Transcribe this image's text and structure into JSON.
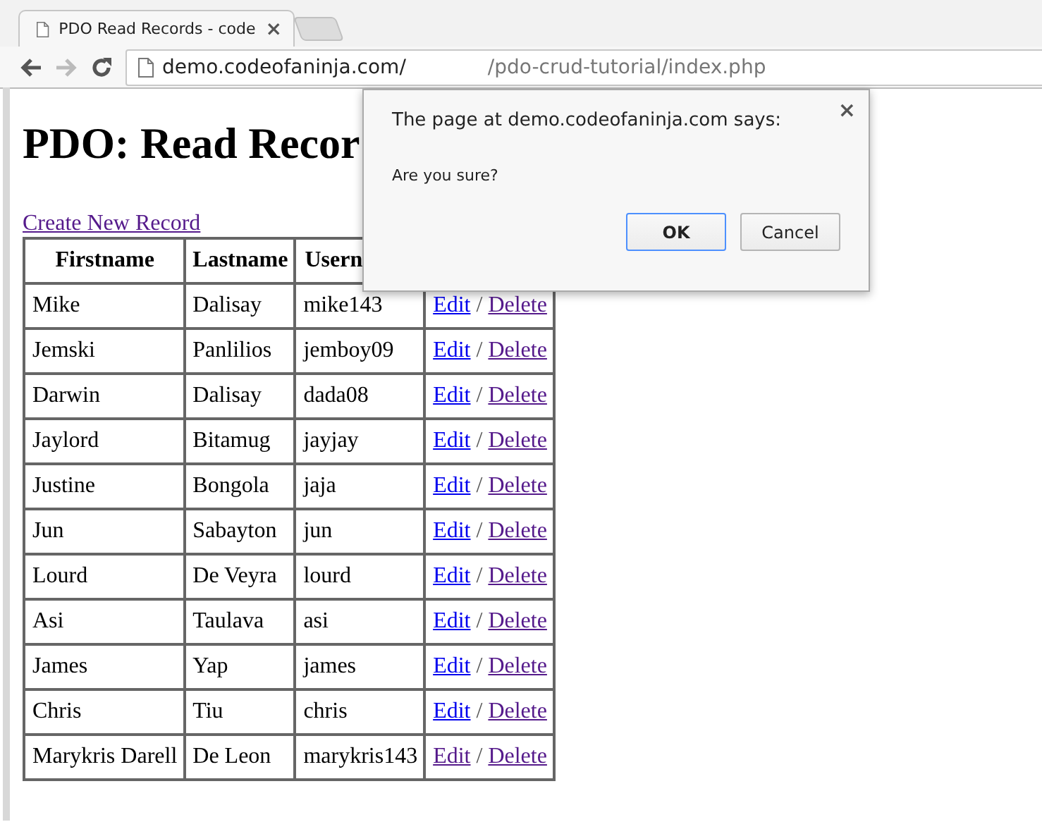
{
  "browser": {
    "tab": {
      "title": "PDO Read Records - code",
      "close": "×"
    },
    "address": {
      "host": "demo.codeofaninja.com/",
      "path": "/pdo-crud-tutorial/index.php"
    }
  },
  "page": {
    "heading": "PDO: Read Recor",
    "create_link": {
      "label": "Create New Record",
      "visited": true
    },
    "table": {
      "columns": [
        "Firstname",
        "Lastname",
        "Usern"
      ],
      "rows": [
        {
          "cells": [
            "Mike",
            "Dalisay",
            "mike143"
          ],
          "edit": {
            "label": "Edit",
            "visited": false
          },
          "sep": "/",
          "delete": {
            "label": "Delete",
            "visited": true
          }
        },
        {
          "cells": [
            "Jemski",
            "Panlilios",
            "jemboy09"
          ],
          "edit": {
            "label": "Edit",
            "visited": false
          },
          "sep": "/",
          "delete": {
            "label": "Delete",
            "visited": true
          }
        },
        {
          "cells": [
            "Darwin",
            "Dalisay",
            "dada08"
          ],
          "edit": {
            "label": "Edit",
            "visited": false
          },
          "sep": "/",
          "delete": {
            "label": "Delete",
            "visited": true
          }
        },
        {
          "cells": [
            "Jaylord",
            "Bitamug",
            "jayjay"
          ],
          "edit": {
            "label": "Edit",
            "visited": false
          },
          "sep": "/",
          "delete": {
            "label": "Delete",
            "visited": true
          }
        },
        {
          "cells": [
            "Justine",
            "Bongola",
            "jaja"
          ],
          "edit": {
            "label": "Edit",
            "visited": false
          },
          "sep": "/",
          "delete": {
            "label": "Delete",
            "visited": true
          }
        },
        {
          "cells": [
            "Jun",
            "Sabayton",
            "jun"
          ],
          "edit": {
            "label": "Edit",
            "visited": false
          },
          "sep": "/",
          "delete": {
            "label": "Delete",
            "visited": true
          }
        },
        {
          "cells": [
            "Lourd",
            "De Veyra",
            "lourd"
          ],
          "edit": {
            "label": "Edit",
            "visited": false
          },
          "sep": "/",
          "delete": {
            "label": "Delete",
            "visited": true
          }
        },
        {
          "cells": [
            "Asi",
            "Taulava",
            "asi"
          ],
          "edit": {
            "label": "Edit",
            "visited": false
          },
          "sep": "/",
          "delete": {
            "label": "Delete",
            "visited": true
          }
        },
        {
          "cells": [
            "James",
            "Yap",
            "james"
          ],
          "edit": {
            "label": "Edit",
            "visited": false
          },
          "sep": "/",
          "delete": {
            "label": "Delete",
            "visited": true
          }
        },
        {
          "cells": [
            "Chris",
            "Tiu",
            "chris"
          ],
          "edit": {
            "label": "Edit",
            "visited": false
          },
          "sep": "/",
          "delete": {
            "label": "Delete",
            "visited": true
          }
        },
        {
          "cells": [
            "Marykris Darell",
            "De Leon",
            "marykris143"
          ],
          "edit": {
            "label": "Edit",
            "visited": true
          },
          "sep": "/",
          "delete": {
            "label": "Delete",
            "visited": true
          }
        }
      ]
    }
  },
  "dialog": {
    "title": "The page at demo.codeofaninja.com says:",
    "close": "×",
    "message": "Are you sure?",
    "buttons": [
      {
        "label": "OK",
        "selected": true
      },
      {
        "label": "Cancel",
        "selected": false
      }
    ]
  }
}
